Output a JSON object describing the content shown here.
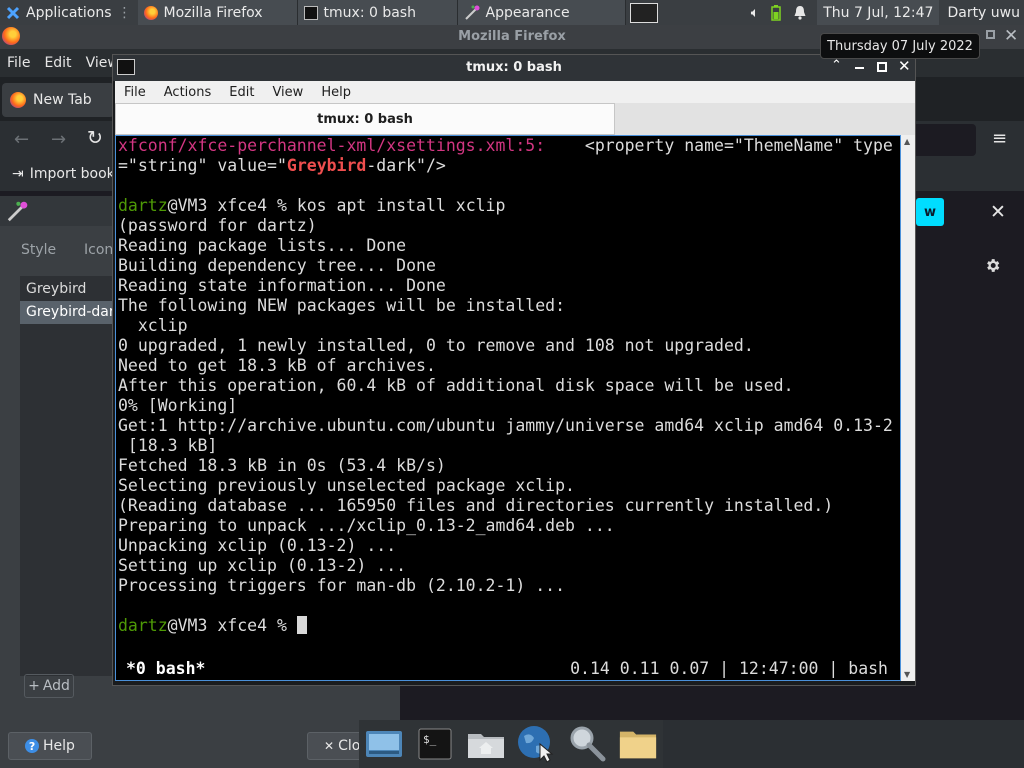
{
  "top_panel": {
    "applications_label": "Applications",
    "tasks": [
      {
        "label": "Mozilla Firefox",
        "icon": "firefox-icon"
      },
      {
        "label": "tmux: 0 bash",
        "icon": "terminal-icon"
      },
      {
        "label": "Appearance",
        "icon": "appearance-icon"
      }
    ],
    "clock": "Thu  7 Jul, 12:47",
    "user": "Darty uwu"
  },
  "tooltip": "Thursday 07 July 2022",
  "firefox": {
    "title": "Mozilla Firefox",
    "menu": [
      "File",
      "Edit",
      "View"
    ],
    "tab_label": "New Tab",
    "bookmark_label": "Import book",
    "notification_fragment": "w"
  },
  "appearance": {
    "tabs": [
      "Style",
      "Icon"
    ],
    "themes": [
      "Greybird",
      "Greybird-dark"
    ],
    "selected_theme": "Greybird-dark",
    "add_label": "Add",
    "help_label": "Help",
    "close_label": "Clo"
  },
  "terminal": {
    "title": "tmux: 0 bash",
    "menu": [
      "File",
      "Actions",
      "Edit",
      "View",
      "Help"
    ],
    "tab_label": "tmux: 0 bash",
    "grep_path": "xfconf/xfce-perchannel-xml/xsettings.xml:5:",
    "grep_line_a": "    <property name=\"ThemeName\" type",
    "grep_line_b_pre": "=\"string\" value=\"",
    "grep_match": "Greybird",
    "grep_line_b_post": "-dark\"/>",
    "prompt_user": "dartz",
    "prompt_host": "@VM3 xfce4 % ",
    "command": "kos apt install xclip",
    "output_before_working": [
      "(password for dartz)",
      "Reading package lists... Done",
      "Building dependency tree... Done",
      "Reading state information... Done",
      "The following NEW packages will be installed:",
      "  xclip",
      "0 upgraded, 1 newly installed, 0 to remove and 108 not upgraded.",
      "Need to get 18.3 kB of archives.",
      "After this operation, 60.4 kB of additional disk space will be used."
    ],
    "working_line": "0% [Working]",
    "output_after_working": [
      "Get:1 http://archive.ubuntu.com/ubuntu jammy/universe amd64 xclip amd64 0.13-2",
      " [18.3 kB]",
      "Fetched 18.3 kB in 0s (53.4 kB/s)",
      "Selecting previously unselected package xclip.",
      "(Reading database ... 165950 files and directories currently installed.)",
      "Preparing to unpack .../xclip_0.13-2_amd64.deb ...",
      "Unpacking xclip (0.13-2) ...",
      "Setting up xclip (0.13-2) ...",
      "Processing triggers for man-db (2.10.2-1) ..."
    ],
    "status_left": "*0 bash*",
    "status_right": "0.14 0.11 0.07 | 12:47:00 | bash"
  },
  "dock": [
    "show-desktop-icon",
    "terminal-icon",
    "home-folder-icon",
    "web-browser-icon",
    "search-icon",
    "folder-icon"
  ],
  "colors": {
    "prompt_green": "#4e9a06",
    "path_magenta": "#d33682",
    "match_red": "#ef4e4e",
    "working_orange": "#cd6d3b",
    "notification_cyan": "#00ddff"
  }
}
